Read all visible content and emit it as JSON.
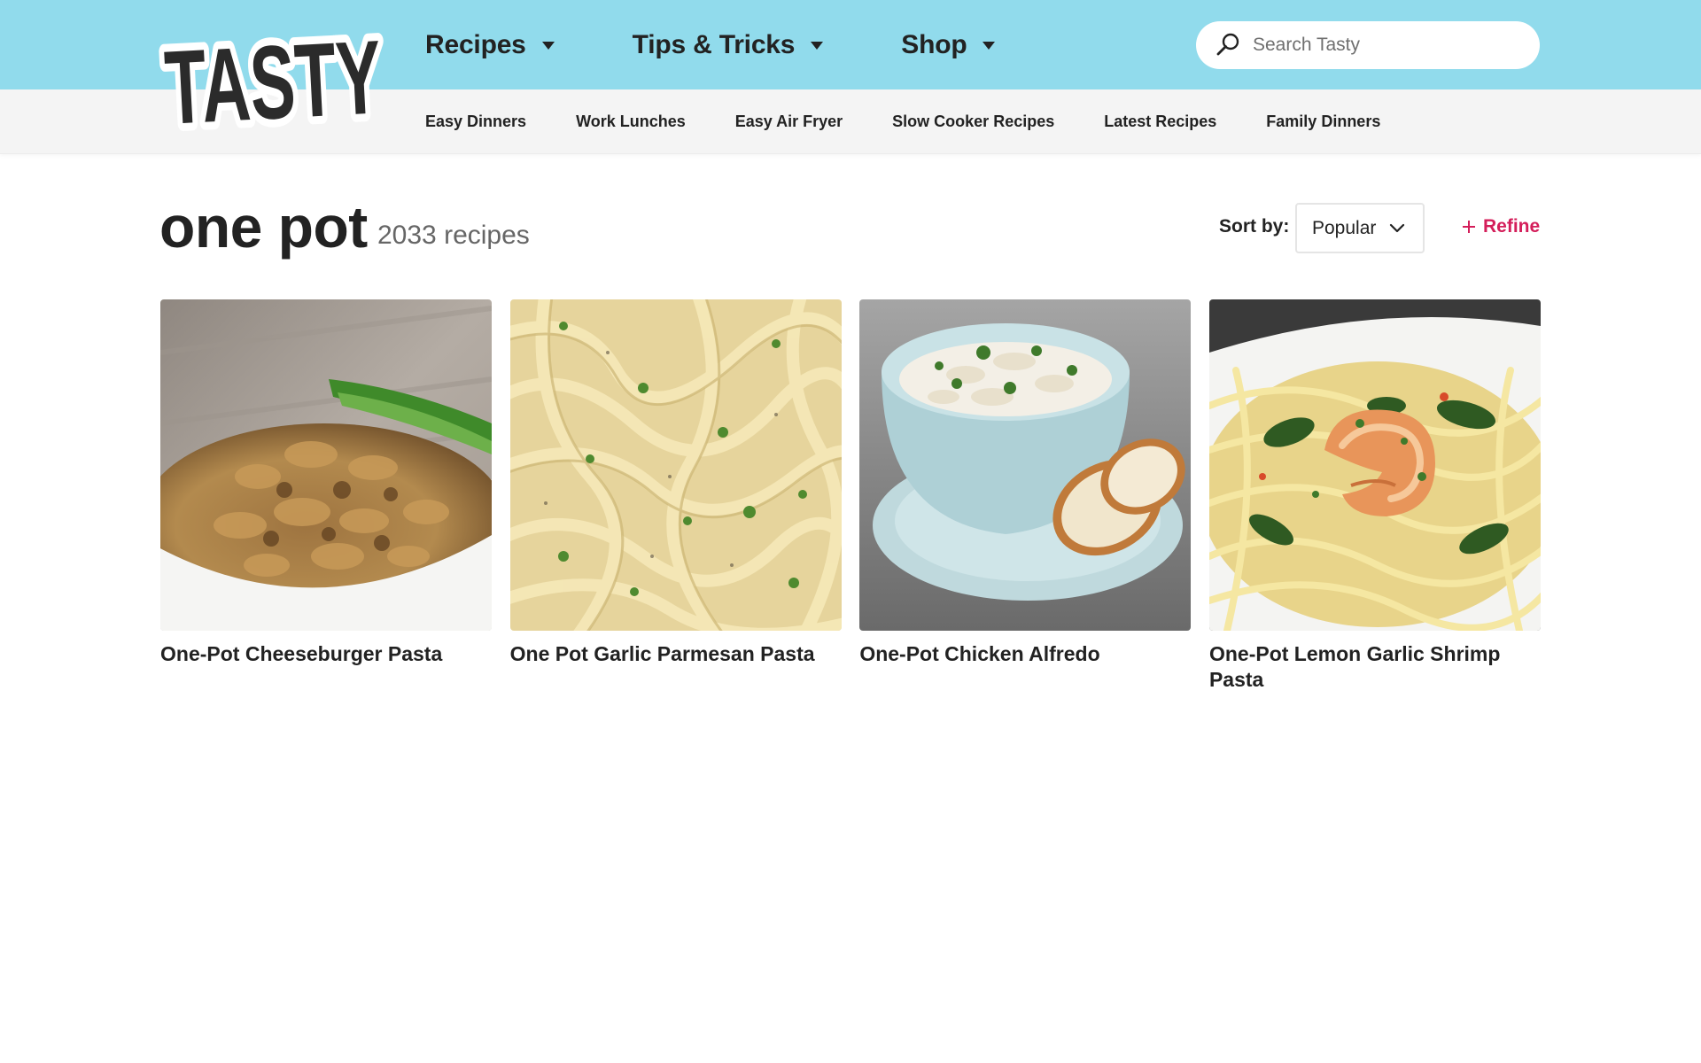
{
  "brand": {
    "logo_text": "TASTY",
    "accent_color": "#91dbec",
    "refine_color": "#d41e5a"
  },
  "nav": {
    "items": [
      {
        "label": "Recipes",
        "icon": "caret-down-icon"
      },
      {
        "label": "Tips & Tricks",
        "icon": "caret-down-icon"
      },
      {
        "label": "Shop",
        "icon": "caret-down-icon"
      }
    ]
  },
  "search": {
    "placeholder": "Search Tasty",
    "value": "",
    "icon": "search-icon"
  },
  "subnav": {
    "items": [
      "Easy Dinners",
      "Work Lunches",
      "Easy Air Fryer",
      "Slow Cooker Recipes",
      "Latest Recipes",
      "Family Dinners"
    ]
  },
  "results": {
    "title": "one pot",
    "count_text": "2033 recipes",
    "sort_label": "Sort by:",
    "sort_value": "Popular",
    "refine_label": "Refine"
  },
  "recipes": [
    {
      "title": "One-Pot Cheeseburger Pasta"
    },
    {
      "title": "One Pot Garlic Parmesan Pasta"
    },
    {
      "title": "One-Pot Chicken Alfredo"
    },
    {
      "title": "One-Pot Lemon Garlic Shrimp Pasta"
    }
  ]
}
